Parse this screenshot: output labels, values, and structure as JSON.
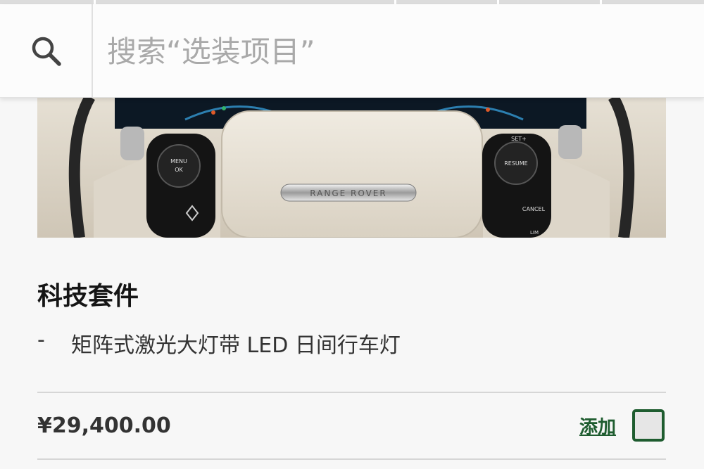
{
  "search": {
    "placeholder": "搜索“选装项目”",
    "value": ""
  },
  "package": {
    "title": "科技套件",
    "features": [
      {
        "bullet": "-",
        "text": "矩阵式激光大灯带 LED 日间行车灯"
      }
    ],
    "price": "¥29,400.00",
    "add_label": "添加",
    "selected": false
  },
  "hero_image": {
    "brand_text": "RANGE ROVER",
    "button_labels": [
      "MENU",
      "OK",
      "RESUME",
      "SET+",
      "CANCEL",
      "LIM"
    ]
  },
  "icons": {
    "search": "search-icon",
    "checkbox": "checkbox-icon"
  },
  "colors": {
    "accent_green": "#1e5c2f",
    "page_bg": "#f7f7f7",
    "divider": "#d6d6d6",
    "placeholder_text": "#a9a9a9"
  }
}
